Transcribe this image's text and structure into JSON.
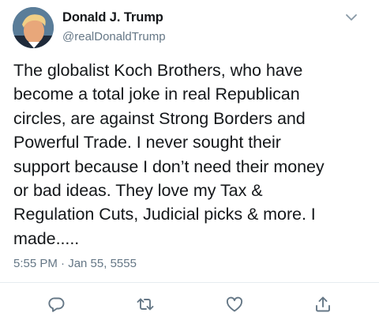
{
  "author": {
    "name": "Donald J. Trump",
    "handle": "@realDonaldTrump"
  },
  "tweet": {
    "text": "The globalist Koch Brothers, who have\nbecome a total joke in real Republican\ncircles, are against Strong Borders and\nPowerful Trade. I never sought their\nsupport because I don’t need their money\nor bad ideas. They love my Tax &\nRegulation Cuts, Judicial picks & more. I\nmade.....",
    "timestamp": "5:55 PM · Jan 55, 5555"
  },
  "actions": {
    "icons": [
      "reply-icon",
      "retweet-icon",
      "like-icon",
      "share-icon"
    ]
  },
  "colors": {
    "text": "#14171a",
    "secondary": "#657786",
    "divider": "#e6ecf0",
    "icon": "#657786"
  }
}
